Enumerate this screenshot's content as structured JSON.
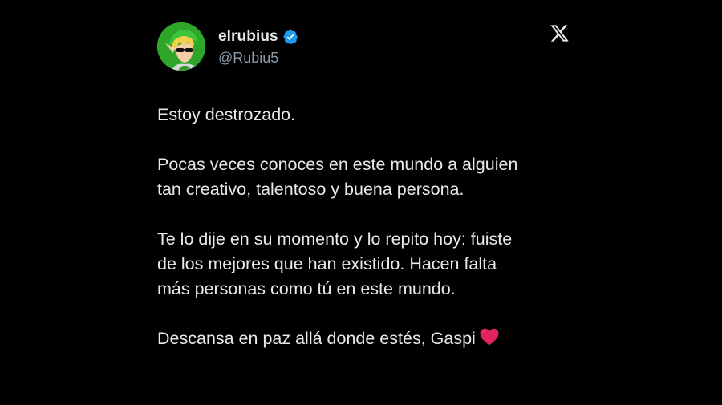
{
  "user": {
    "display_name": "elrubius",
    "handle": "@Rubiu5",
    "verified": true
  },
  "platform_logo": "x-logo-icon",
  "tweet": {
    "paragraphs": [
      [
        "Estoy destrozado."
      ],
      [
        "Pocas veces conoces en este mundo a alguien",
        "tan creativo, talentoso y buena persona."
      ],
      [
        "Te lo dije en su momento y lo repito hoy: fuiste",
        "de los mejores que han existido. Hacen falta",
        "más personas como tú en este mundo."
      ],
      [
        "Descansa en paz allá donde estés, Gaspi"
      ]
    ],
    "trailing_emoji": "red-heart-icon"
  },
  "colors": {
    "background": "#000000",
    "text_primary": "#e7e9ea",
    "text_secondary": "#8b98a5",
    "verified_badge": "#1d9bf0",
    "heart": "#e0245e"
  }
}
